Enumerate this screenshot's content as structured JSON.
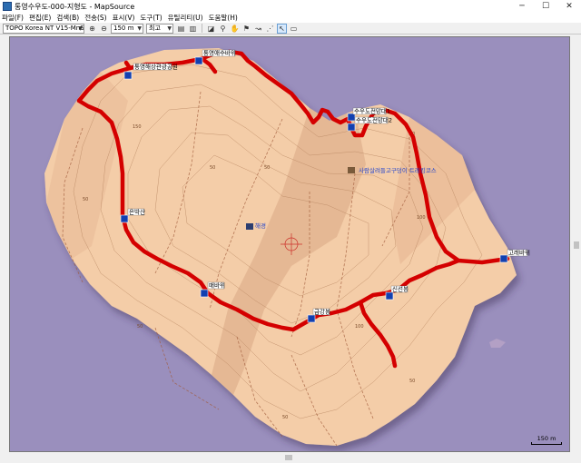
{
  "window": {
    "title": "통영수우도-000-지형도 - MapSource",
    "minimize": "─",
    "maximize": "☐",
    "close": "✕"
  },
  "menu": [
    "파일(F)",
    "편집(E)",
    "검색(B)",
    "전송(S)",
    "표시(V)",
    "도구(T)",
    "유틸리티(U)",
    "도움말(H)"
  ],
  "toolbar": {
    "map_product": "TOPO Korea NT V15-MnSoft",
    "zoom_scale": "150 m",
    "detail_level": "최고"
  },
  "map": {
    "background": "#9a8fbd",
    "terrain": "#f4cda8",
    "track_color": "#d40000",
    "waypoints": [
      "통영해상관광공원",
      "통영애수바위",
      "수우도전망대1",
      "수우도전망대2",
      "사람살려들고구덩이 트레킹코스",
      "해경",
      "은박산",
      "매바위",
      "고래바위",
      "신선봉",
      "금강봉"
    ],
    "scale_label": "150 m"
  }
}
